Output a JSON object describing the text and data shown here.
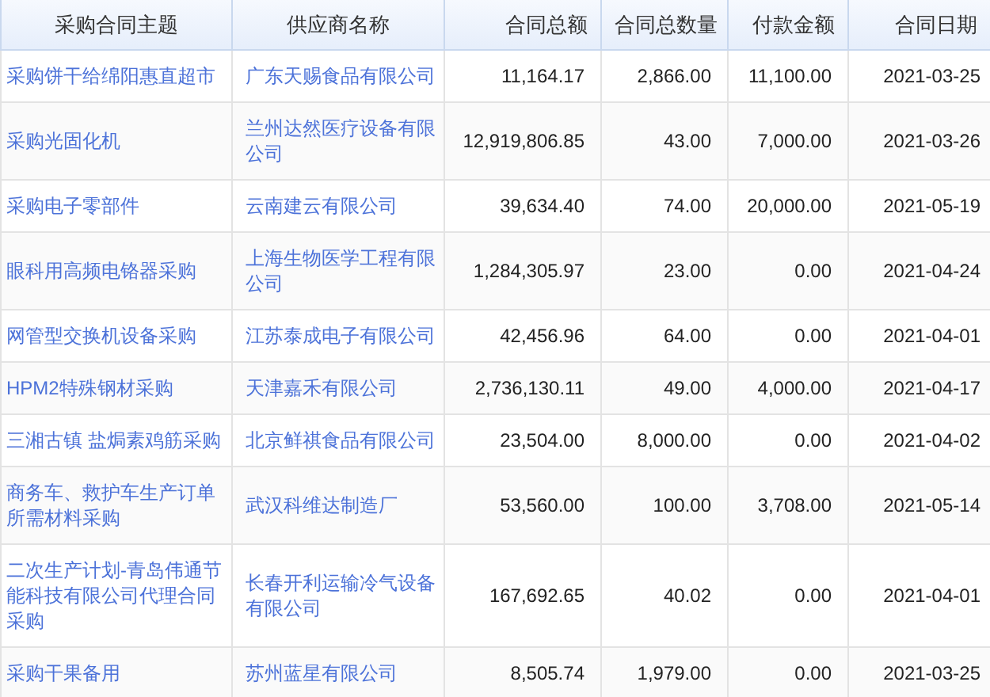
{
  "table": {
    "columns": [
      "采购合同主题",
      "供应商名称",
      "合同总额",
      "合同总数量",
      "付款金额",
      "合同日期"
    ],
    "rows": [
      {
        "subject": "采购饼干给绵阳惠直超市",
        "supplier": "广东天赐食品有限公司",
        "total": "11,164.17",
        "quantity": "2,866.00",
        "paid": "11,100.00",
        "date": "2021-03-25"
      },
      {
        "subject": "采购光固化机",
        "supplier": "兰州达然医疗设备有限公司",
        "total": "12,919,806.85",
        "quantity": "43.00",
        "paid": "7,000.00",
        "date": "2021-03-26"
      },
      {
        "subject": "采购电子零部件",
        "supplier": "云南建云有限公司",
        "total": "39,634.40",
        "quantity": "74.00",
        "paid": "20,000.00",
        "date": "2021-05-19"
      },
      {
        "subject": "眼科用高频电铬器采购",
        "supplier": "上海生物医学工程有限公司",
        "total": "1,284,305.97",
        "quantity": "23.00",
        "paid": "0.00",
        "date": "2021-04-24"
      },
      {
        "subject": "网管型交换机设备采购",
        "supplier": "江苏泰成电子有限公司",
        "total": "42,456.96",
        "quantity": "64.00",
        "paid": "0.00",
        "date": "2021-04-01"
      },
      {
        "subject": "HPM2特殊钢材采购",
        "supplier": "天津嘉禾有限公司",
        "total": "2,736,130.11",
        "quantity": "49.00",
        "paid": "4,000.00",
        "date": "2021-04-17"
      },
      {
        "subject": "三湘古镇 盐焗素鸡筋采购",
        "supplier": "北京鲜祺食品有限公司",
        "total": "23,504.00",
        "quantity": "8,000.00",
        "paid": "0.00",
        "date": "2021-04-02"
      },
      {
        "subject": "商务车、救护车生产订单所需材料采购",
        "supplier": "武汉科维达制造厂",
        "total": "53,560.00",
        "quantity": "100.00",
        "paid": "3,708.00",
        "date": "2021-05-14"
      },
      {
        "subject": "二次生产计划-青岛伟通节能科技有限公司代理合同采购",
        "supplier": "长春开利运输冷气设备有限公司",
        "total": "167,692.65",
        "quantity": "40.02",
        "paid": "0.00",
        "date": "2021-04-01"
      },
      {
        "subject": "采购干果备用",
        "supplier": "苏州蓝星有限公司",
        "total": "8,505.74",
        "quantity": "1,979.00",
        "paid": "0.00",
        "date": "2021-03-25"
      }
    ]
  }
}
